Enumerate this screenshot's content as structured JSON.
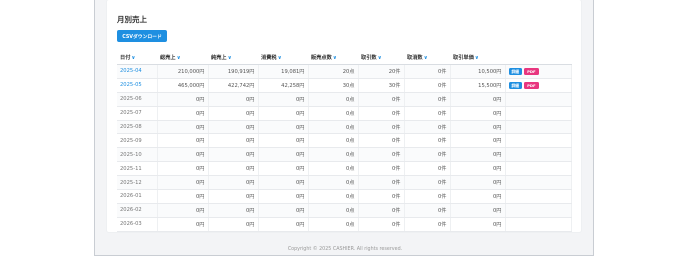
{
  "page": {
    "title": "月別売上",
    "csv_button": "CSVダウンロード"
  },
  "table": {
    "headers": [
      "日付",
      "総売上",
      "純売上",
      "消費税",
      "販売点数",
      "取引数",
      "取消数",
      "取引単価"
    ],
    "rows": [
      {
        "date": "2025-04",
        "gross": "210,000円",
        "net": "190,919円",
        "tax": "19,081円",
        "items": "20点",
        "trans": "20件",
        "cancel": "0件",
        "unit": "10,500円",
        "actions": true
      },
      {
        "date": "2025-05",
        "gross": "465,000円",
        "net": "422,742円",
        "tax": "42,258円",
        "items": "30点",
        "trans": "30件",
        "cancel": "0件",
        "unit": "15,500円",
        "actions": true
      },
      {
        "date": "2025-06",
        "gross": "0円",
        "net": "0円",
        "tax": "0円",
        "items": "0点",
        "trans": "0件",
        "cancel": "0件",
        "unit": "0円",
        "actions": false
      },
      {
        "date": "2025-07",
        "gross": "0円",
        "net": "0円",
        "tax": "0円",
        "items": "0点",
        "trans": "0件",
        "cancel": "0件",
        "unit": "0円",
        "actions": false
      },
      {
        "date": "2025-08",
        "gross": "0円",
        "net": "0円",
        "tax": "0円",
        "items": "0点",
        "trans": "0件",
        "cancel": "0件",
        "unit": "0円",
        "actions": false
      },
      {
        "date": "2025-09",
        "gross": "0円",
        "net": "0円",
        "tax": "0円",
        "items": "0点",
        "trans": "0件",
        "cancel": "0件",
        "unit": "0円",
        "actions": false
      },
      {
        "date": "2025-10",
        "gross": "0円",
        "net": "0円",
        "tax": "0円",
        "items": "0点",
        "trans": "0件",
        "cancel": "0件",
        "unit": "0円",
        "actions": false
      },
      {
        "date": "2025-11",
        "gross": "0円",
        "net": "0円",
        "tax": "0円",
        "items": "0点",
        "trans": "0件",
        "cancel": "0件",
        "unit": "0円",
        "actions": false
      },
      {
        "date": "2025-12",
        "gross": "0円",
        "net": "0円",
        "tax": "0円",
        "items": "0点",
        "trans": "0件",
        "cancel": "0件",
        "unit": "0円",
        "actions": false
      },
      {
        "date": "2026-01",
        "gross": "0円",
        "net": "0円",
        "tax": "0円",
        "items": "0点",
        "trans": "0件",
        "cancel": "0件",
        "unit": "0円",
        "actions": false
      },
      {
        "date": "2026-02",
        "gross": "0円",
        "net": "0円",
        "tax": "0円",
        "items": "0点",
        "trans": "0件",
        "cancel": "0件",
        "unit": "0円",
        "actions": false
      },
      {
        "date": "2026-03",
        "gross": "0円",
        "net": "0円",
        "tax": "0円",
        "items": "0点",
        "trans": "0件",
        "cancel": "0件",
        "unit": "0円",
        "actions": false
      }
    ],
    "action_labels": {
      "detail": "詳細",
      "pdf": "PDF"
    }
  },
  "footer": {
    "text": "Copyright © 2025 CASHIER. All rights reserved."
  },
  "colors": {
    "accent": "#1e8fe1",
    "pdf": "#e8367f"
  }
}
